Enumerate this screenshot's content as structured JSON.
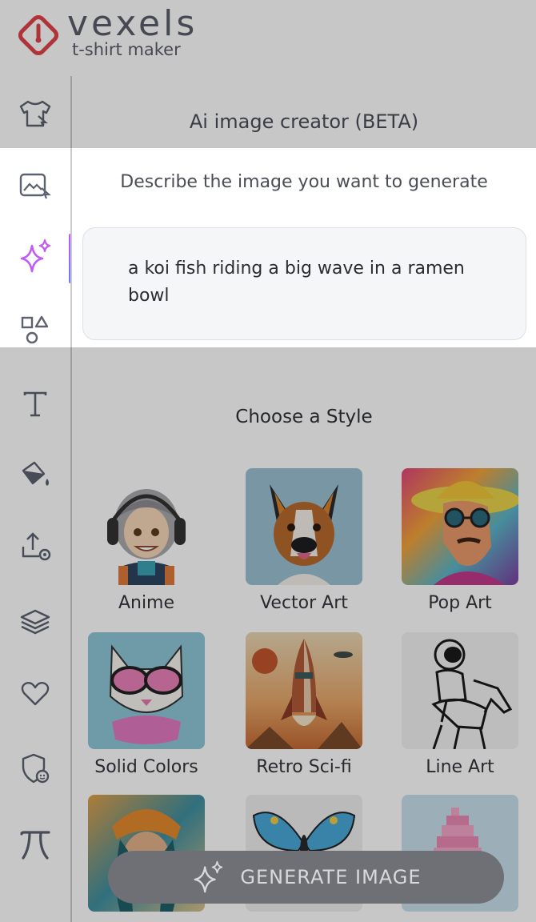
{
  "brand": {
    "name": "vexels",
    "tagline": "t-shirt maker",
    "logo_color": "#e0424a"
  },
  "panel": {
    "title": "Ai image creator (BETA)",
    "prompt_label": "Describe the image you want to generate",
    "prompt_value": "a koi fish riding a big wave in a ramen bowl",
    "style_heading": "Choose a Style"
  },
  "sidebar": {
    "items": [
      {
        "name": "tshirt-icon"
      },
      {
        "name": "image-upload-icon"
      },
      {
        "name": "sparkle-icon",
        "active": true,
        "accent": "#c05cf0"
      },
      {
        "name": "shapes-icon"
      },
      {
        "name": "text-icon"
      },
      {
        "name": "paint-bucket-icon"
      },
      {
        "name": "upload-icon"
      },
      {
        "name": "layers-icon"
      },
      {
        "name": "heart-icon"
      },
      {
        "name": "shield-icon"
      },
      {
        "name": "pi-icon"
      }
    ]
  },
  "styles": [
    {
      "label": "Anime"
    },
    {
      "label": "Vector Art"
    },
    {
      "label": "Pop Art"
    },
    {
      "label": "Solid Colors"
    },
    {
      "label": "Retro Sci-fi"
    },
    {
      "label": "Line Art"
    },
    {
      "label": ""
    },
    {
      "label": ""
    },
    {
      "label": ""
    }
  ],
  "generate_button": {
    "label": "GENERATE IMAGE"
  }
}
